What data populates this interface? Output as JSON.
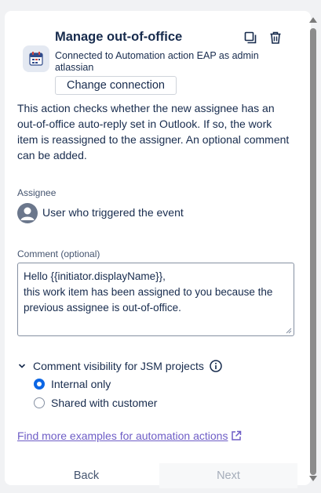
{
  "header": {
    "title": "Manage out-of-office",
    "connection_text": "Connected to Automation action EAP as admin atlassian",
    "change_connection_label": "Change connection",
    "icons": [
      "calendar-icon",
      "duplicate-icon",
      "trash-icon"
    ]
  },
  "description": "This action checks whether the new assignee has an out-of-office auto-reply set in Outlook. If so, the work item is reassigned to the assigner. An optional comment can be added.",
  "assignee": {
    "label": "Assignee",
    "value": "User who triggered the event"
  },
  "comment": {
    "label": "Comment (optional)",
    "value": "Hello {{initiator.displayName}},\nthis work item has been assigned to you because the previous assignee is out-of-office."
  },
  "visibility": {
    "label": "Comment visibility for JSM projects",
    "options": [
      {
        "label": "Internal only",
        "selected": true
      },
      {
        "label": "Shared with customer",
        "selected": false
      }
    ]
  },
  "link_text": "Find more examples for automation actions",
  "footer": {
    "back_label": "Back",
    "next_label": "Next"
  },
  "colors": {
    "accent": "#0c66e4",
    "link": "#6e5dc6",
    "text": "#172b4d"
  }
}
